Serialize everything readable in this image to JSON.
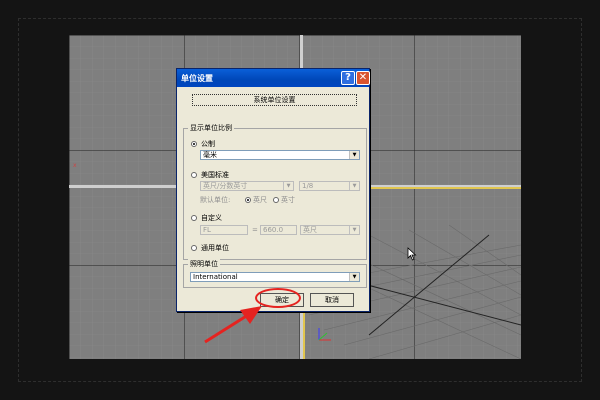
{
  "dialog": {
    "title": "单位设置",
    "help_btn": "?",
    "close_btn": "✕",
    "system_units_button": "系统单位设置",
    "display_group_label": "显示单位比例",
    "metric_label": "公制",
    "metric_value": "毫米",
    "us_label": "美国标准",
    "us_value": "英尺/分数英寸",
    "us_fraction_value": "1/8",
    "default_unit_label": "默认单位:",
    "feet_label": "英尺",
    "inch_label": "英寸",
    "custom_label": "自定义",
    "custom_name": "FL",
    "custom_equals": "=",
    "custom_value": "660.0",
    "custom_unit": "英尺",
    "generic_label": "通用单位",
    "lighting_group_label": "照明单位",
    "lighting_value": "International",
    "ok_label": "确定",
    "cancel_label": "取消"
  },
  "colors": {
    "highlight": "#e52320",
    "titlebar": "#0047b8",
    "active_viewport": "#e1c64f"
  },
  "icons": {
    "arrow": "red-arrow-icon",
    "cursor": "mouse-cursor-icon",
    "axis": "axis-tripod-icon"
  }
}
